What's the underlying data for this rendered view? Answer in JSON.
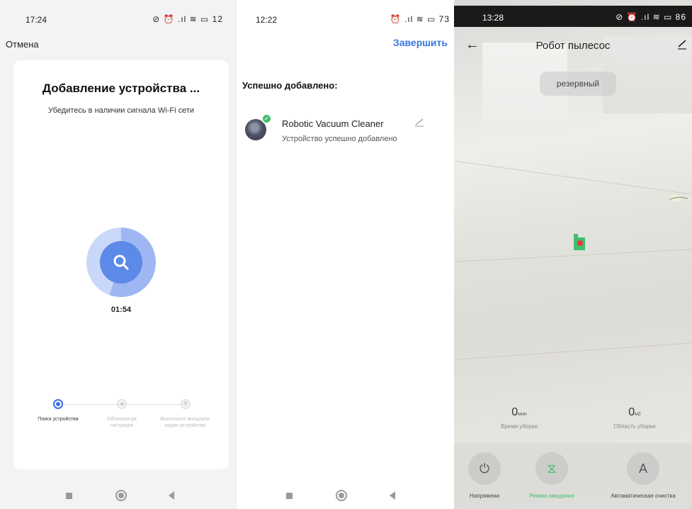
{
  "panel1": {
    "status": {
      "time": "17:24",
      "icons": "⊘ ⏰ .ıl ≋ ▭ 12"
    },
    "cancel_label": "Отмена",
    "title": "Добавление устройства ...",
    "subtitle": "Убедитесь в наличии сигнала Wi-Fi сети",
    "timer": "01:54",
    "steps": [
      {
        "label": "Поиск устройства",
        "state": "active"
      },
      {
        "label": "Облачная ре гистрация",
        "state": "inactive"
      },
      {
        "label": "Выполните инициали зацию устройства",
        "state": "inactive"
      }
    ]
  },
  "panel2": {
    "status": {
      "time": "12:22",
      "icons": "⏰ .ıl ≋ ▭ 73"
    },
    "finish_label": "Завершить",
    "added_heading": "Успешно добавлено:",
    "device": {
      "name": "Robotic Vacuum Cleaner",
      "status": "Устройство успешно добавлено"
    }
  },
  "panel3": {
    "status": {
      "time": "13:28",
      "icons": "⊘ ⏰ .ıl ≋ ▭ 86"
    },
    "title": "Робот пылесос",
    "mode_pill": "резервный",
    "stats": [
      {
        "value": "0",
        "unit": "мин",
        "label": "Время уборки"
      },
      {
        "value": "0",
        "unit": "м2",
        "label": "Область уборки"
      }
    ],
    "controls": [
      {
        "glyph": "⏻",
        "label": "Напряжени",
        "active": false
      },
      {
        "glyph": "⧖",
        "label": "Режим ожидания",
        "active": true
      },
      {
        "glyph": "A",
        "label": "Автоматическая очистка",
        "active": false
      }
    ]
  },
  "colors": {
    "accent_blue": "#3a77e0",
    "success_green": "#3fbf6e"
  }
}
